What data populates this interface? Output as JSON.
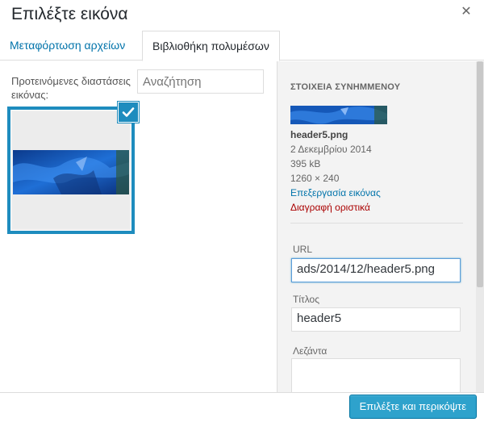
{
  "modal": {
    "title": "Επιλέξτε εικόνα",
    "close_icon": "close-icon"
  },
  "tabs": [
    {
      "label": "Μεταφόρτωση αρχείων",
      "active": false
    },
    {
      "label": "Βιβλιοθήκη πολυμέσων",
      "active": true
    }
  ],
  "browser": {
    "filter_label": "Προτεινόμενες διαστάσεις εικόνας:",
    "search_placeholder": "Αναζήτηση",
    "selected_icon": "check-icon"
  },
  "details": {
    "heading": "ΣΤΟΙΧΕΙΑ ΣΥΝΗΜΜΕΝΟΥ",
    "filename": "header5.png",
    "date": "2 Δεκεμβρίου 2014",
    "filesize": "395 kB",
    "dimensions": "1260 × 240",
    "edit_link": "Επεξεργασία εικόνας",
    "delete_link": "Διαγραφή οριστικά"
  },
  "fields": {
    "url_label": "URL",
    "url_value": "ads/2014/12/header5.png",
    "title_label": "Τίτλος",
    "title_value": "header5",
    "caption_label": "Λεζάντα",
    "caption_value": ""
  },
  "toolbar": {
    "select_crop_label": "Επιλέξτε και περικόψτε"
  },
  "colors": {
    "accent": "#1e8cbe",
    "button": "#2ea2cc",
    "link": "#0073aa",
    "delete": "#aa0000"
  }
}
